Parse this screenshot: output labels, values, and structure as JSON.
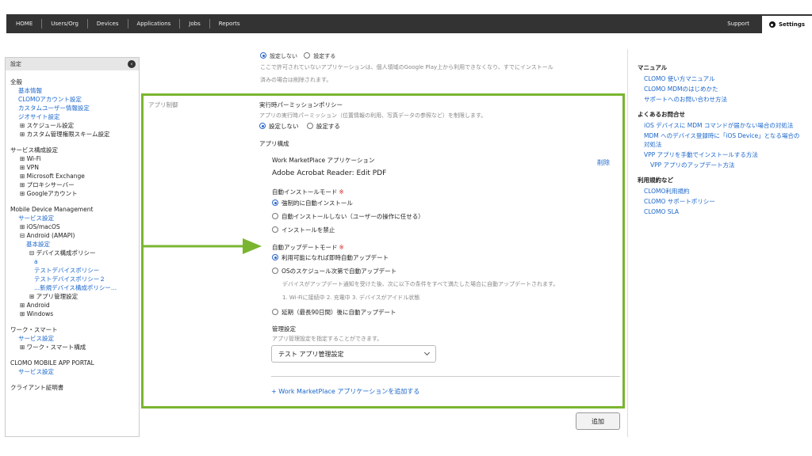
{
  "nav": {
    "items": [
      "HOME",
      "Users/Org",
      "Devices",
      "Applications",
      "Jobs",
      "Reports"
    ],
    "support": "Support",
    "settings": "Settings"
  },
  "sidebar": {
    "header": "設定",
    "collapse_icon": "chevron-left-icon",
    "groups": [
      {
        "title": "全般",
        "items": [
          {
            "label": "基本情報",
            "type": "link",
            "level": 1
          },
          {
            "label": "CLOMOアカウント設定",
            "type": "link",
            "level": 1
          },
          {
            "label": "カスタムユーザー情報設定",
            "type": "link",
            "level": 1
          },
          {
            "label": "ジオサイト設定",
            "type": "link",
            "level": 1
          },
          {
            "label": "⊞ スケジュール設定",
            "type": "tree",
            "level": 1
          },
          {
            "label": "⊞ カスタム管理権限スキーム設定",
            "type": "tree",
            "level": 1
          }
        ]
      },
      {
        "title": "サービス構成設定",
        "items": [
          {
            "label": "⊞ Wi-Fi",
            "type": "tree",
            "level": 1
          },
          {
            "label": "⊞ VPN",
            "type": "tree",
            "level": 1
          },
          {
            "label": "⊞ Microsoft Exchange",
            "type": "tree",
            "level": 1
          },
          {
            "label": "⊞ プロキシサーバー",
            "type": "tree",
            "level": 1
          },
          {
            "label": "⊞ Googleアカウント",
            "type": "tree",
            "level": 1
          }
        ]
      },
      {
        "title": "Mobile Device Management",
        "items": [
          {
            "label": "サービス設定",
            "type": "link",
            "level": 1
          },
          {
            "label": "⊞ iOS/macOS",
            "type": "tree",
            "level": 1
          },
          {
            "label": "⊟ Android (AMAPI)",
            "type": "tree",
            "level": 1
          },
          {
            "label": "基本設定",
            "type": "link",
            "level": 2
          },
          {
            "label": "⊟ デバイス構成ポリシー",
            "type": "tree",
            "level": 2
          },
          {
            "label": "a",
            "type": "link",
            "level": 3
          },
          {
            "label": "テストデバイスポリシー",
            "type": "link",
            "level": 3
          },
          {
            "label": "テストデバイスポリシー２",
            "type": "link",
            "level": 3
          },
          {
            "label": "...新規デバイス構成ポリシー...",
            "type": "link",
            "level": 3
          },
          {
            "label": "⊞ アプリ管理設定",
            "type": "tree",
            "level": 2
          },
          {
            "label": "⊞ Android",
            "type": "tree",
            "level": 1
          },
          {
            "label": "⊞ Windows",
            "type": "tree",
            "level": 1
          }
        ]
      },
      {
        "title": "ワーク・スマート",
        "items": [
          {
            "label": "サービス設定",
            "type": "link",
            "level": 1
          },
          {
            "label": "⊞ ワーク・スマート構成",
            "type": "tree",
            "level": 1
          }
        ]
      },
      {
        "title": "CLOMO MOBILE APP PORTAL",
        "items": [
          {
            "label": "サービス設定",
            "type": "link",
            "level": 1
          }
        ]
      },
      {
        "title": "クライアント証明書",
        "items": []
      }
    ]
  },
  "main": {
    "top_radio_off": "設定しない",
    "top_radio_on": "設定する",
    "top_note_1": "ここで許可されていないアプリケーションは、個人領域のGoogle Play上から利用できなくなり、すでにインストール",
    "top_note_2": "済みの場合は削除されます。",
    "section_label": "アプリ制御",
    "runtime_title": "実行時パーミッションポリシー",
    "runtime_desc": "アプリの実行時パーミッション（位置情報の利用、写真データの参照など）を制限します。",
    "runtime_off": "設定しない",
    "runtime_on": "設定する",
    "app_config_title": "アプリ構成",
    "wm_app_title": "Work MarketPlace アプリケーション",
    "wm_app_name": "Adobe Acrobat Reader: Edit PDF",
    "delete_label": "削除",
    "install_mode_title": "自動インストールモード",
    "install_opts": [
      "強制的に自動インストール",
      "自動インストールしない（ユーザーの操作に任せる）",
      "インストールを禁止"
    ],
    "update_mode_title": "自動アップデートモード",
    "update_opt1": "利用可能になれば即時自動アップデート",
    "update_opt2": "OSのスケジュール次第で自動アップデート",
    "update_opt2_desc1": "デバイスがアップデート通知を受けた後、次に以下の条件をすべて満たした場合に自動アップデートされます。",
    "update_opt2_desc2": "1. Wi-Fiに接続中 2. 充電中 3. デバイスがアイドル状態",
    "update_opt3": "延期（最長90日間）後に自動アップデート",
    "mgmt_title": "管理設定",
    "mgmt_desc": "アプリ管理設定を指定することができます。",
    "mgmt_select": "テスト アプリ管理設定",
    "add_wm_link": "+ Work MarketPlace アプリケーションを追加する",
    "add_button": "追加",
    "required_mark": "※",
    "highlight_color": "#7ab530"
  },
  "right": {
    "sections": [
      {
        "title": "マニュアル",
        "links": [
          {
            "label": "CLOMO 使い方マニュアル"
          },
          {
            "label": "CLOMO MDMのはじめかた"
          },
          {
            "label": "サポートへのお問い合わせ方法"
          }
        ]
      },
      {
        "title": "よくあるお問合せ",
        "links": [
          {
            "label": "iOS デバイスに MDM コマンドが届かない場合の対処法"
          },
          {
            "label": "MDM へのデバイス登録時に「iOS Device」となる場合の対処法"
          },
          {
            "label": "VPP アプリを手動でインストールする方法"
          },
          {
            "label": "VPP アプリのアップデート方法",
            "sub": true
          }
        ]
      },
      {
        "title": "利用規約など",
        "links": [
          {
            "label": "CLOMO利用規約"
          },
          {
            "label": "CLOMO サポートポリシー"
          },
          {
            "label": "CLOMO SLA"
          }
        ]
      }
    ]
  }
}
